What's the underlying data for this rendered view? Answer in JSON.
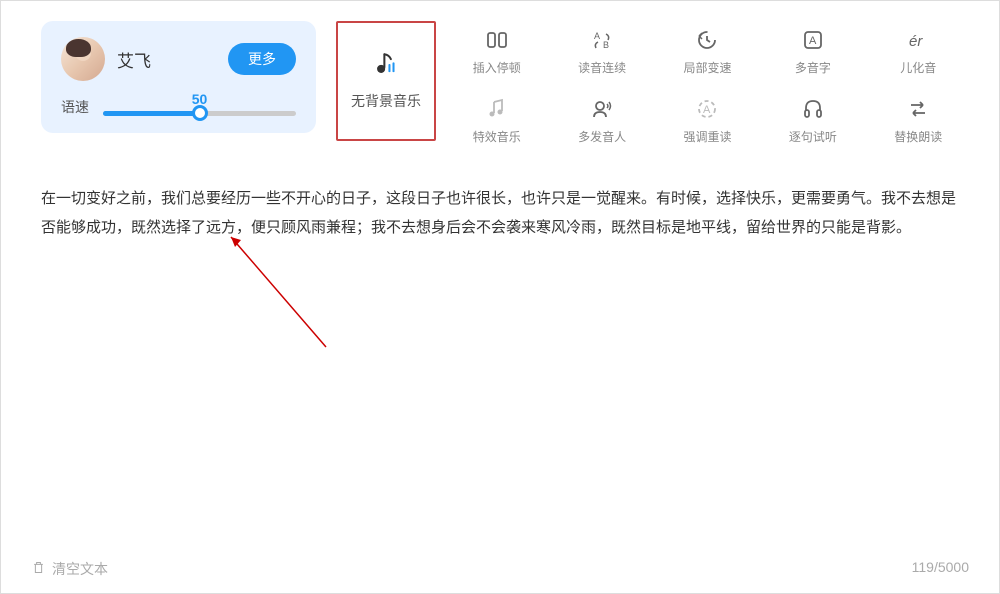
{
  "voice": {
    "name": "艾飞",
    "more_btn": "更多",
    "speed_label": "语速",
    "speed_value": "50"
  },
  "bg_music": {
    "label": "无背景音乐"
  },
  "tools": {
    "insert_pause": "插入停顿",
    "continuous_reading": "读音连续",
    "local_speed": "局部变速",
    "polyphone": "多音字",
    "erhua": "儿化音",
    "effect_music": "特效音乐",
    "multi_voice": "多发音人",
    "emphasis": "强调重读",
    "sentence_preview": "逐句试听",
    "replace_reading": "替换朗读"
  },
  "content": {
    "text": "在一切变好之前，我们总要经历一些不开心的日子，这段日子也许很长，也许只是一觉醒来。有时候，选择快乐，更需要勇气。我不去想是否能够成功，既然选择了远方，便只顾风雨兼程；我不去想身后会不会袭来寒风冷雨，既然目标是地平线，留给世界的只能是背影。"
  },
  "footer": {
    "clear": "清空文本",
    "counter": "119/5000"
  }
}
